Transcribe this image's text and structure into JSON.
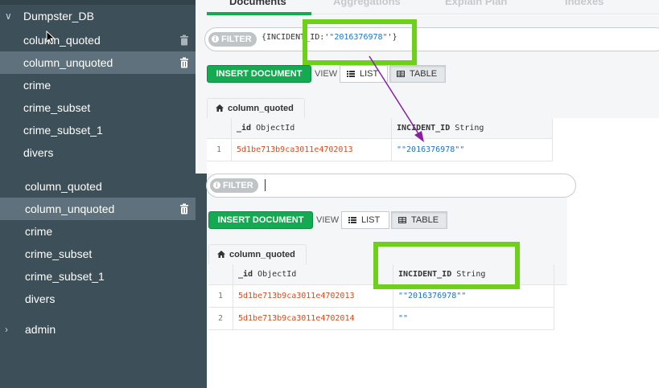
{
  "sidebar": {
    "database": "Dumpster_DB",
    "collections_top": [
      {
        "label": "column_quoted"
      },
      {
        "label": "column_unquoted"
      },
      {
        "label": "crime"
      },
      {
        "label": "crime_subset"
      },
      {
        "label": "crime_subset_1"
      },
      {
        "label": "divers"
      }
    ],
    "collections_bottom": [
      {
        "label": "column_quoted"
      },
      {
        "label": "column_unquoted"
      },
      {
        "label": "crime"
      },
      {
        "label": "crime_subset"
      },
      {
        "label": "crime_subset_1"
      },
      {
        "label": "divers"
      }
    ],
    "admin_db": "admin"
  },
  "tabs": [
    "Documents",
    "Aggregations",
    "Explain Plan",
    "Indexes"
  ],
  "top_view": {
    "filter_label": "FILTER",
    "query_open": "{INCIDENT_ID:'",
    "query_value": "\"2016376978\"",
    "query_close": "'}",
    "insert_label": "INSERT DOCUMENT",
    "view_label": "VIEW",
    "list_label": "LIST",
    "table_label": "TABLE",
    "collection_tab": "column_quoted",
    "headers": {
      "id_name": "_id",
      "id_type": "ObjectId",
      "field_name": "INCIDENT_ID",
      "field_type": "String"
    },
    "rows": [
      {
        "num": "1",
        "id": "5d1be713b9ca3011e4702013",
        "value": "\"\"2016376978\"\""
      }
    ]
  },
  "bottom_view": {
    "filter_label": "FILTER",
    "insert_label": "INSERT DOCUMENT",
    "view_label": "VIEW",
    "list_label": "LIST",
    "table_label": "TABLE",
    "collection_tab": "column_quoted",
    "headers": {
      "id_name": "_id",
      "id_type": "ObjectId",
      "field_name": "INCIDENT_ID",
      "field_type": "String"
    },
    "rows": [
      {
        "num": "1",
        "id": "5d1be713b9ca3011e4702013",
        "value": "\"\"2016376978\"\""
      },
      {
        "num": "2",
        "id": "5d1be713b9ca3011e4702014",
        "value": "\"\""
      }
    ]
  },
  "colors": {
    "accent": "#13aa52",
    "highlight": "#6fd01a",
    "arrow": "#8a1fa3",
    "sidebar": "#3d4f58"
  }
}
